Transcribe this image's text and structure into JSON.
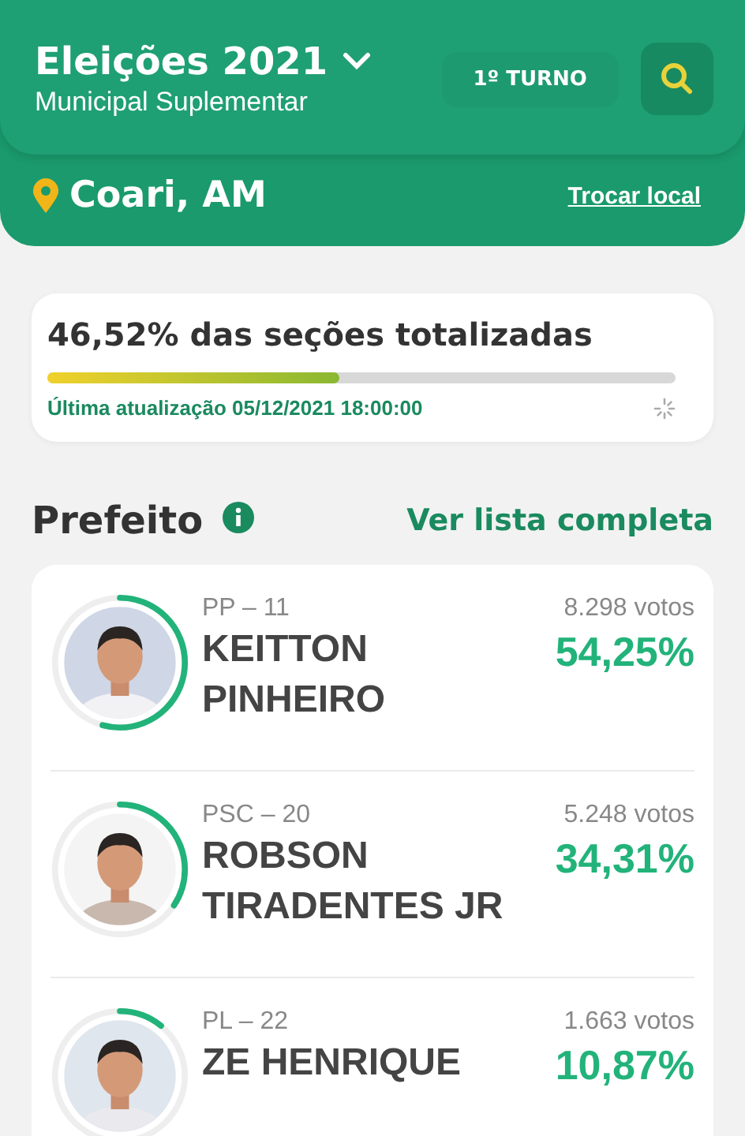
{
  "header": {
    "title": "Eleições 2021",
    "subtitle": "Municipal Suplementar",
    "round": "1º TURNO",
    "location": "Coari, AM",
    "change_location": "Trocar local"
  },
  "progress": {
    "text": "46,52% das seções totalizadas",
    "level": 0.4652,
    "updated": "Última atualização 05/12/2021 18:00:00"
  },
  "section": {
    "title": "Prefeito",
    "link": "Ver lista completa"
  },
  "candidates": [
    {
      "party": "PP – 11",
      "name": "KEITTON PINHEIRO",
      "votes": "8.298 votos",
      "percent": "54,25%"
    },
    {
      "party": "PSC – 20",
      "name": "ROBSON TIRADENTES JR",
      "votes": "5.248 votos",
      "percent": "34,31%"
    },
    {
      "party": "PL – 22",
      "name": "ZE HENRIQUE",
      "votes": "1.663 votos",
      "percent": "10,87%"
    }
  ]
}
